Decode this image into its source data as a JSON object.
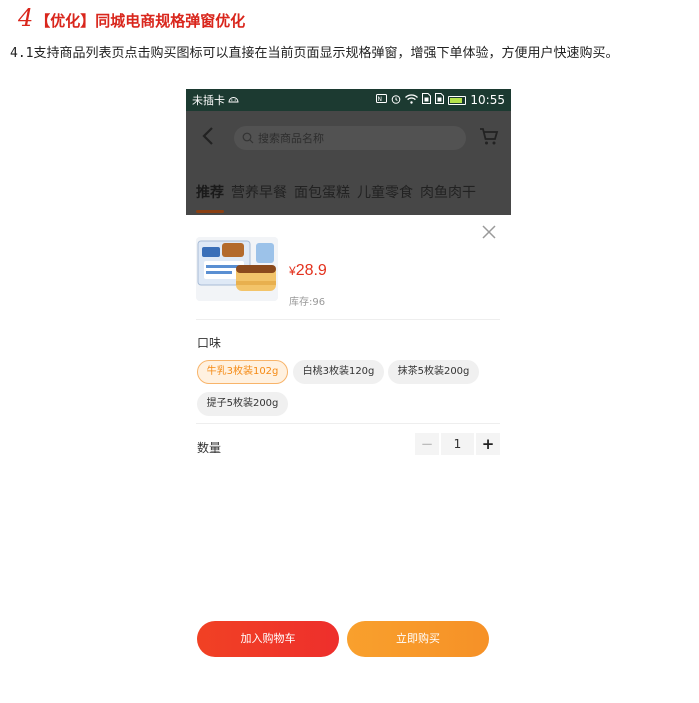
{
  "doc": {
    "number": "4",
    "title": "【优化】同城电商规格弹窗优化",
    "description": "4.1支持商品列表页点击购买图标可以直接在当前页面显示规格弹窗，增强下单体验，方便用户快速购买。"
  },
  "status_bar": {
    "carrier": "未插卡",
    "time": "10:55",
    "icons": [
      "android-icon",
      "nfc-icon",
      "alarm-icon",
      "wifi-icon",
      "sim-icon",
      "sim-icon",
      "battery-icon"
    ]
  },
  "header": {
    "search_placeholder": "搜索商品名称",
    "categories": [
      "推荐",
      "营养早餐",
      "面包蛋糕",
      "儿童零食",
      "肉鱼肉干"
    ],
    "active_category_index": 0
  },
  "sheet": {
    "currency": "¥",
    "price": "28.9",
    "stock": "库存:96",
    "flavor_label": "口味",
    "flavors": [
      "牛乳3枚装102g",
      "白桃3枚装120g",
      "抹茶5枚装200g",
      "提子5枚装200g"
    ],
    "selected_flavor_index": 0,
    "quantity_label": "数量",
    "quantity": "1",
    "minus": "−",
    "plus": "+",
    "add_to_cart": "加入购物车",
    "buy_now": "立即购买"
  },
  "colors": {
    "accent_red": "#e3311d",
    "accent_orange": "#f69127",
    "overlay": "#474747"
  }
}
